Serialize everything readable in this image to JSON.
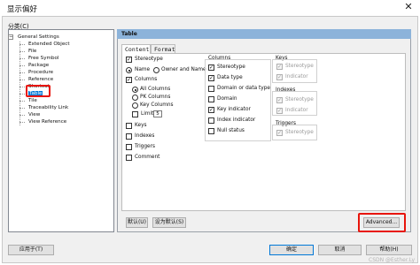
{
  "window": {
    "title": "显示偏好",
    "close_glyph": "✕"
  },
  "category_label": "分类(C)",
  "tree": {
    "collapse_glyph": "−",
    "items": [
      {
        "label": "General Settings",
        "level": 0
      },
      {
        "label": "Extended Object",
        "level": 1
      },
      {
        "label": "File",
        "level": 1
      },
      {
        "label": "Free Symbol",
        "level": 1
      },
      {
        "label": "Package",
        "level": 1
      },
      {
        "label": "Procedure",
        "level": 1
      },
      {
        "label": "Reference",
        "level": 1
      },
      {
        "label": "Shortcut",
        "level": 1
      },
      {
        "label": "Table",
        "level": 1,
        "selected": true
      },
      {
        "label": "Tile",
        "level": 1
      },
      {
        "label": "Traceability Link",
        "level": 1
      },
      {
        "label": "View",
        "level": 1
      },
      {
        "label": "View Reference",
        "level": 1
      }
    ]
  },
  "panel": {
    "title": "Table",
    "tabs": [
      {
        "label": "Content",
        "active": true
      },
      {
        "label": "Format",
        "active": false
      }
    ],
    "left": {
      "stereotype": {
        "label": "Stereotype",
        "checked": true
      },
      "name_radio": "Name",
      "owner_radio": "Owner and Name",
      "columns": {
        "label": "Columns",
        "checked": true
      },
      "all_columns": "All Columns",
      "pk_columns": "PK Columns",
      "key_columns": "Key Columns",
      "limit": {
        "label": "Limit:",
        "value": "5"
      },
      "keys": "Keys",
      "indexes": "Indexes",
      "triggers": "Triggers",
      "comment": "Comment"
    },
    "columns_group": {
      "title": "Columns",
      "items": [
        {
          "label": "Stereotype",
          "checked": true
        },
        {
          "label": "Data type",
          "checked": true
        },
        {
          "label": "Domain or data type",
          "checked": false
        },
        {
          "label": "Domain",
          "checked": false
        },
        {
          "label": "Key indicator",
          "checked": true
        },
        {
          "label": "Index indicator",
          "checked": false
        },
        {
          "label": "Null status",
          "checked": false
        }
      ]
    },
    "keys_group": {
      "title": "Keys",
      "items": [
        "Stereotype",
        "Indicator"
      ]
    },
    "indexes_group": {
      "title": "Indexes",
      "items": [
        "Stereotype",
        "Indicator"
      ]
    },
    "triggers_group": {
      "title": "Triggers",
      "items": [
        "Stereotype"
      ]
    },
    "default_button": "默认(U)",
    "set_default_button": "设为默认(S)",
    "advanced_button": "Advanced..."
  },
  "footer": {
    "apply_to_button": "应用于(T)",
    "ok_button": "确定",
    "cancel_button": "取消",
    "help_button": "帮助(H)"
  },
  "watermark": "CSDN @Esther.Ly",
  "colors": {
    "selection": "#0078d7",
    "highlight_box": "#e8150c",
    "panel_header": "#8cb3da"
  }
}
